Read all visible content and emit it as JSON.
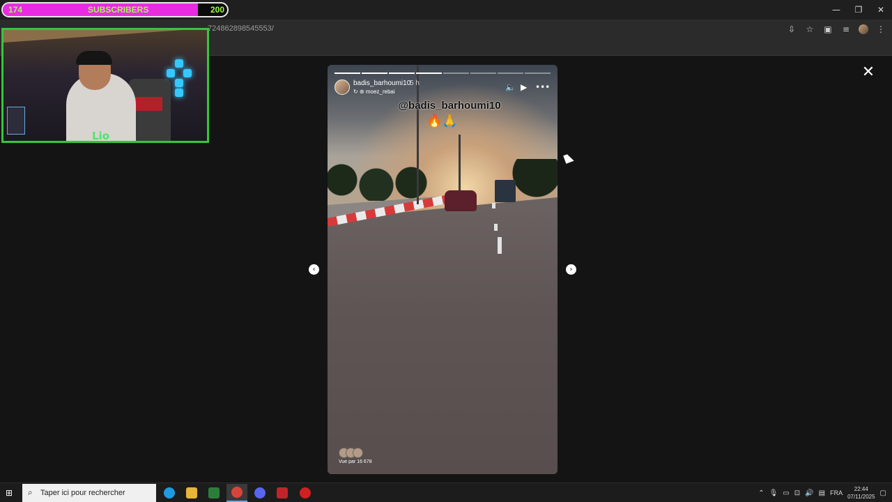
{
  "browser": {
    "url_fragment": "724862898545553/",
    "window_controls": {
      "minimize": "—",
      "restore": "❐",
      "close": "✕"
    },
    "icons": [
      "install-app-icon",
      "bookmark-star-icon",
      "extensions-icon",
      "media-controls-icon",
      "profile-avatar-icon",
      "kebab-menu-icon"
    ]
  },
  "overlay": {
    "subscribers": {
      "current": "174",
      "label": "SUBSCRIBERS",
      "goal": "200",
      "progress": 0.87,
      "fill_color": "#e82be3",
      "text_color": "#9dff46"
    },
    "webcam": {
      "border_color": "#37c63c",
      "logo_text": "Lio"
    }
  },
  "story": {
    "username": "badis_barhoumi10",
    "time": "5 h",
    "repost_from": "moez_rebai",
    "mention": "@badis_barhoumi10",
    "emojis": "🔥🙏",
    "viewed_by": "Vue par 16 678",
    "segments_total": 8,
    "segments_done": 4
  },
  "viewer": {
    "close": "✕",
    "prev": "‹",
    "next": "›"
  },
  "taskbar": {
    "search_placeholder": "Taper ici pour rechercher",
    "language": "FRA",
    "time": "22:44",
    "date": "07/11/2025",
    "apps": [
      {
        "name": "edge-icon",
        "color": "#1e9be0"
      },
      {
        "name": "file-explorer-icon",
        "color": "#e6b53a"
      },
      {
        "name": "store-icon",
        "color": "#2d7d3a"
      },
      {
        "name": "chrome-icon",
        "color": "#d9443a"
      },
      {
        "name": "discord-icon",
        "color": "#5865f2"
      },
      {
        "name": "voicemeeter-icon",
        "color": "#c0242a"
      },
      {
        "name": "obs-icon",
        "color": "#d02020"
      }
    ]
  }
}
